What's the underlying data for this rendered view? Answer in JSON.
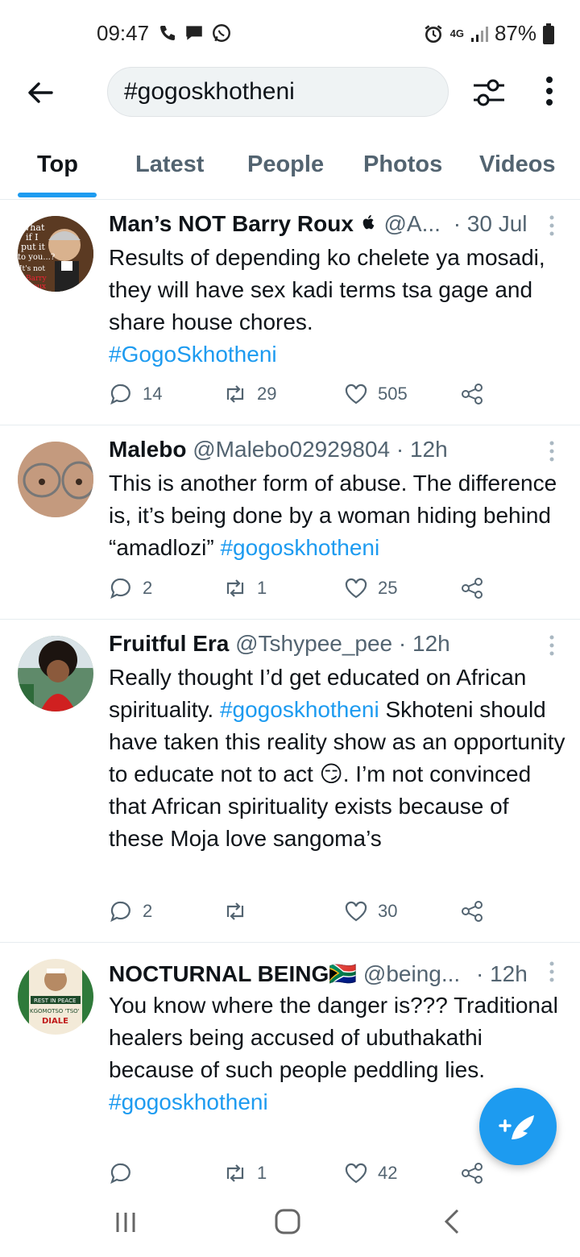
{
  "status_bar": {
    "time": "09:47",
    "network": "4G",
    "battery": "87%",
    "icons": [
      "wifi-call-icon",
      "message-icon",
      "whatsapp-icon",
      "alarm-icon",
      "signal-icon",
      "battery-icon"
    ]
  },
  "header": {
    "search_value": "#gogoskhotheni",
    "icons": [
      "back-arrow-icon",
      "filter-icon",
      "more-vertical-icon"
    ]
  },
  "tabs": [
    "Top",
    "Latest",
    "People",
    "Photos",
    "Videos"
  ],
  "tweets": [
    {
      "name": "Man’s NOT Barry Roux",
      "handle": "@A...",
      "time": "· 30 Jul",
      "text": "Results of depending ko chelete ya mosadi, they will have sex kadi terms tsa gage and share house chores.",
      "hashtag": "#GogoSkhotheni",
      "replies": "14",
      "retweets": "29",
      "likes": "505",
      "avatar_text": [
        "What",
        "if I",
        "put it",
        "to you...?",
        "It's not",
        "Barry",
        "Roux"
      ]
    },
    {
      "name": "Malebo",
      "handle": "@Malebo02929804",
      "time": "· 12h",
      "text_before": "This is another form of abuse. The difference is, it’s being done by a woman hiding behind “amadlozi”",
      "hashtag": "#gogoskhotheni",
      "replies": "2",
      "retweets": "1",
      "likes": "25"
    },
    {
      "name": "Fruitful Era",
      "handle": "@Tshypee_pee",
      "time": "· 12h",
      "text_before": "Really thought I’d get educated on African spirituality.",
      "hashtag": "#gogoskhotheni",
      "text_after": "Skhoteni should have taken this reality show as an opportunity to educate not to act",
      "emoji": "😏",
      "text_end": ". I’m not convinced that African spirituality exists because of these Moja love sangoma’s",
      "replies": "2",
      "retweets": "",
      "likes": "30"
    },
    {
      "name": "NOCTURNAL BEING",
      "flag": "🇿🇦",
      "handle": "@being...",
      "time": "· 12h",
      "text": "You know where the danger is??? Traditional healers being accused of ubuthakathi because of such people peddling lies.",
      "hashtag": "#gogoskhotheni",
      "replies": "",
      "retweets": "1",
      "likes": "42",
      "avatar_text": [
        "REST IN PEACE",
        "KGOMOTSO 'TSO'",
        "DIALE"
      ]
    }
  ],
  "fab": {
    "icon": "compose-tweet-icon"
  },
  "nav": {
    "icons": [
      "recent-apps-icon",
      "home-icon",
      "back-icon"
    ]
  },
  "colors": {
    "accent": "#1d9bf0",
    "text": "#0f1419",
    "muted": "#536471"
  }
}
